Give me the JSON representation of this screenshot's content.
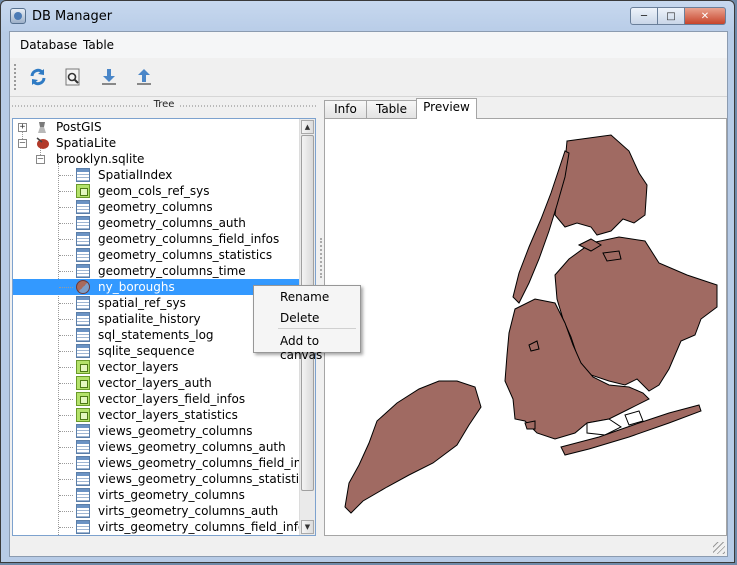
{
  "window": {
    "title": "DB Manager"
  },
  "menu": [
    "Database",
    "Table"
  ],
  "toolbar": [
    {
      "name": "refresh-icon"
    },
    {
      "name": "sql-window-icon"
    },
    {
      "name": "import-layer-icon"
    },
    {
      "name": "export-layer-icon"
    }
  ],
  "tree": {
    "header": "Tree",
    "providers": [
      "PostGIS",
      "SpatiaLite"
    ],
    "database": "brooklyn.sqlite",
    "items": [
      {
        "label": "SpatialIndex",
        "icon": "table"
      },
      {
        "label": "geom_cols_ref_sys",
        "icon": "geom"
      },
      {
        "label": "geometry_columns",
        "icon": "table"
      },
      {
        "label": "geometry_columns_auth",
        "icon": "table"
      },
      {
        "label": "geometry_columns_field_infos",
        "icon": "table"
      },
      {
        "label": "geometry_columns_statistics",
        "icon": "table"
      },
      {
        "label": "geometry_columns_time",
        "icon": "table"
      },
      {
        "label": "ny_boroughs",
        "icon": "layer",
        "selected": true
      },
      {
        "label": "spatial_ref_sys",
        "icon": "table"
      },
      {
        "label": "spatialite_history",
        "icon": "table"
      },
      {
        "label": "sql_statements_log",
        "icon": "table"
      },
      {
        "label": "sqlite_sequence",
        "icon": "table"
      },
      {
        "label": "vector_layers",
        "icon": "geom"
      },
      {
        "label": "vector_layers_auth",
        "icon": "geom"
      },
      {
        "label": "vector_layers_field_infos",
        "icon": "geom"
      },
      {
        "label": "vector_layers_statistics",
        "icon": "geom"
      },
      {
        "label": "views_geometry_columns",
        "icon": "table"
      },
      {
        "label": "views_geometry_columns_auth",
        "icon": "table"
      },
      {
        "label": "views_geometry_columns_field_infos",
        "icon": "table"
      },
      {
        "label": "views_geometry_columns_statistics",
        "icon": "table"
      },
      {
        "label": "virts_geometry_columns",
        "icon": "table"
      },
      {
        "label": "virts_geometry_columns_auth",
        "icon": "table"
      },
      {
        "label": "virts_geometry_columns_field_infos",
        "icon": "table"
      }
    ]
  },
  "tabs": [
    "Info",
    "Table",
    "Preview"
  ],
  "active_tab": "Preview",
  "context_menu": {
    "rename": "Rename",
    "delete": "Delete",
    "add_to_canvas": "Add to canvas"
  },
  "colors": {
    "map_fill": "#a06a62",
    "selection": "#3399ff"
  }
}
